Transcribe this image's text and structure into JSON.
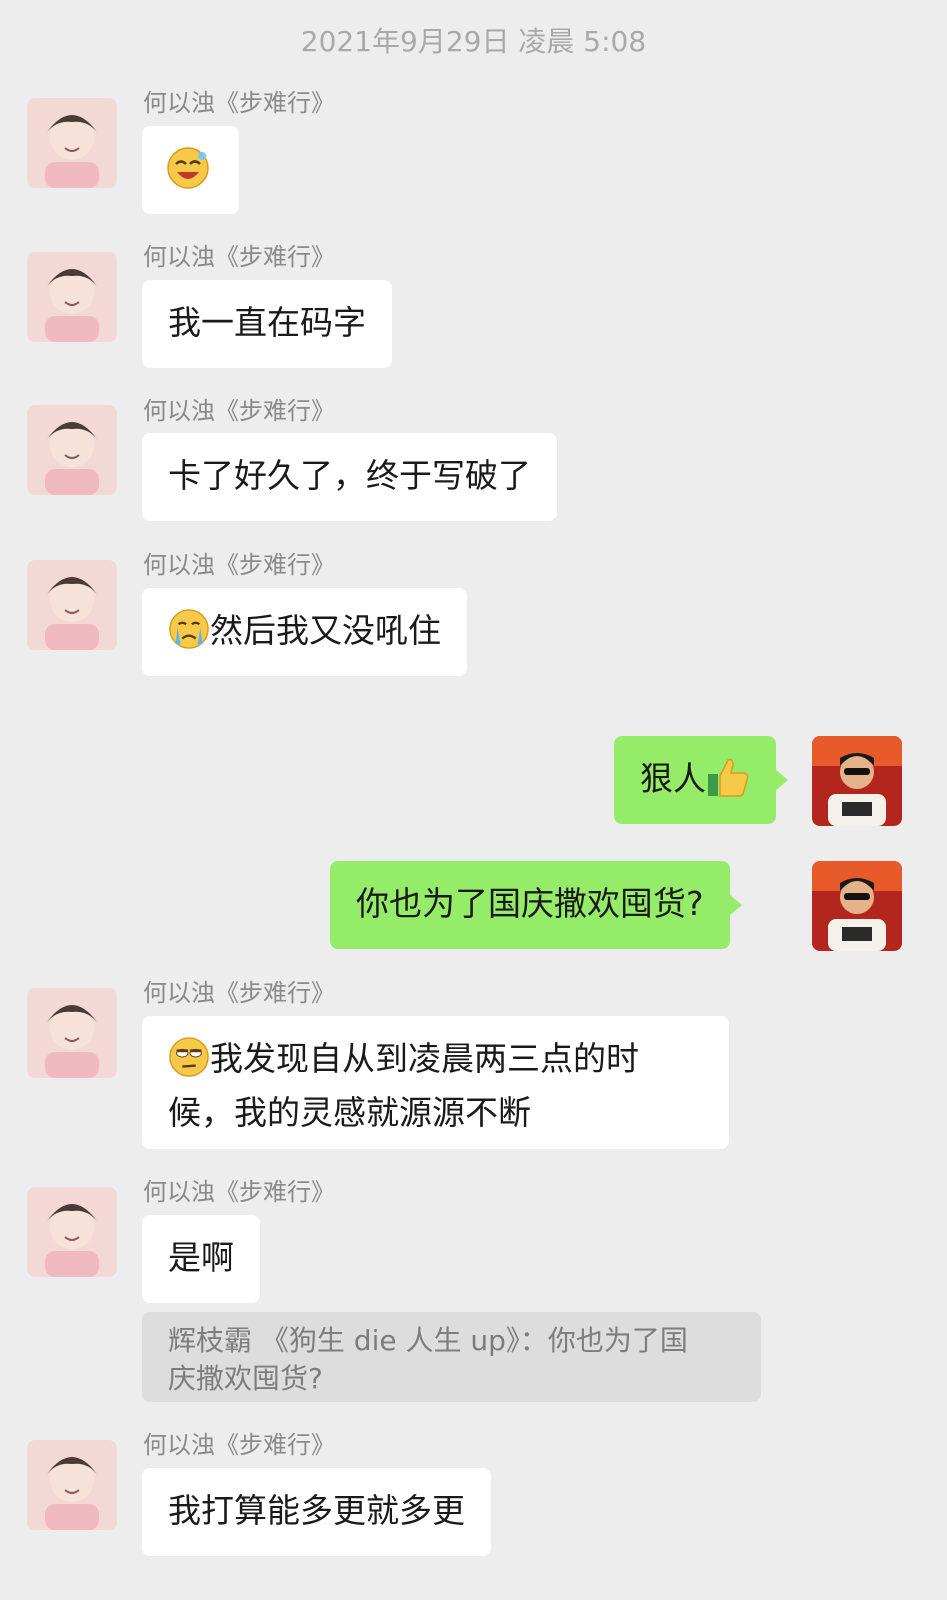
{
  "timestamp": "2021年9月29日 凌晨 5:08",
  "sender_name": "何以浊《步难行》",
  "messages": [
    {
      "side": "left",
      "text": ""
    },
    {
      "side": "left",
      "text": "我一直在码字"
    },
    {
      "side": "left",
      "text": "卡了好久了，终于写破了"
    },
    {
      "side": "left",
      "text": "然后我又没吼住"
    },
    {
      "side": "right",
      "text": "狠人"
    },
    {
      "side": "right",
      "text": "你也为了国庆撒欢囤货?"
    },
    {
      "side": "left",
      "text_line1": "我发现自从到凌晨两三点的时",
      "text_line2": "候，我的灵感就源源不断"
    },
    {
      "side": "left",
      "text": "是啊",
      "quote_line1": "辉枝霸 《狗生 die 人生 up》：你也为了国",
      "quote_line2": "庆撒欢囤货?"
    },
    {
      "side": "left",
      "text": "我打算能多更就多更"
    }
  ],
  "icons": [
    "laughing-sweat-emoji",
    "crying-emoji",
    "thumbs-up-emoji",
    "eye-roll-emoji"
  ],
  "colors": {
    "background": "#ededed",
    "incoming_bubble": "#ffffff",
    "outgoing_bubble": "#95ec69",
    "quote_bg": "#dddddd"
  }
}
